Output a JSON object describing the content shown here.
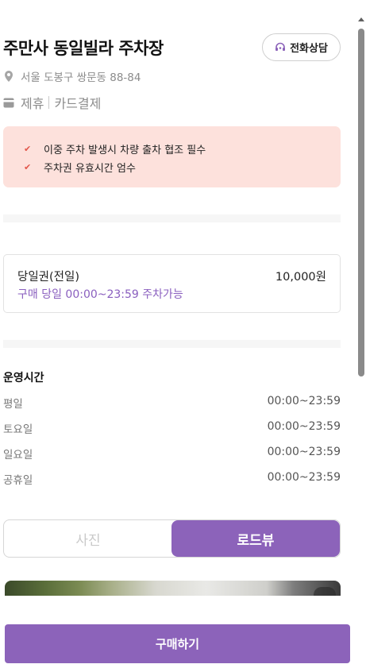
{
  "lot": {
    "title": "주만사 동일빌라 주차장",
    "address": "서울 도봉구 쌍문동 88-84",
    "tags": [
      "제휴",
      "카드결제"
    ]
  },
  "actions": {
    "call_label": "전화상담",
    "buy_label": "구매하기"
  },
  "notices": [
    "이중 주차 발생시 차량 출차 협조 필수",
    "주차권 유효시간 엄수"
  ],
  "ticket": {
    "name": "당일권(전일)",
    "price": "10,000원",
    "description": "구매 당일 00:00~23:59 주차가능"
  },
  "hours": {
    "title": "운영시간",
    "rows": [
      {
        "day": "평일",
        "time": "00:00~23:59"
      },
      {
        "day": "토요일",
        "time": "00:00~23:59"
      },
      {
        "day": "일요일",
        "time": "00:00~23:59"
      },
      {
        "day": "공휴일",
        "time": "00:00~23:59"
      }
    ]
  },
  "view_toggle": {
    "photo_label": "사진",
    "roadview_label": "로드뷰",
    "selected": "로드뷰"
  },
  "colors": {
    "accent": "#8c63ba",
    "notice_bg": "#fde1dc",
    "check": "#e2574c"
  },
  "icons": {
    "call": "headset-icon",
    "address": "location-pin-icon",
    "tags": "card-icon",
    "notice_check": "check-icon"
  }
}
